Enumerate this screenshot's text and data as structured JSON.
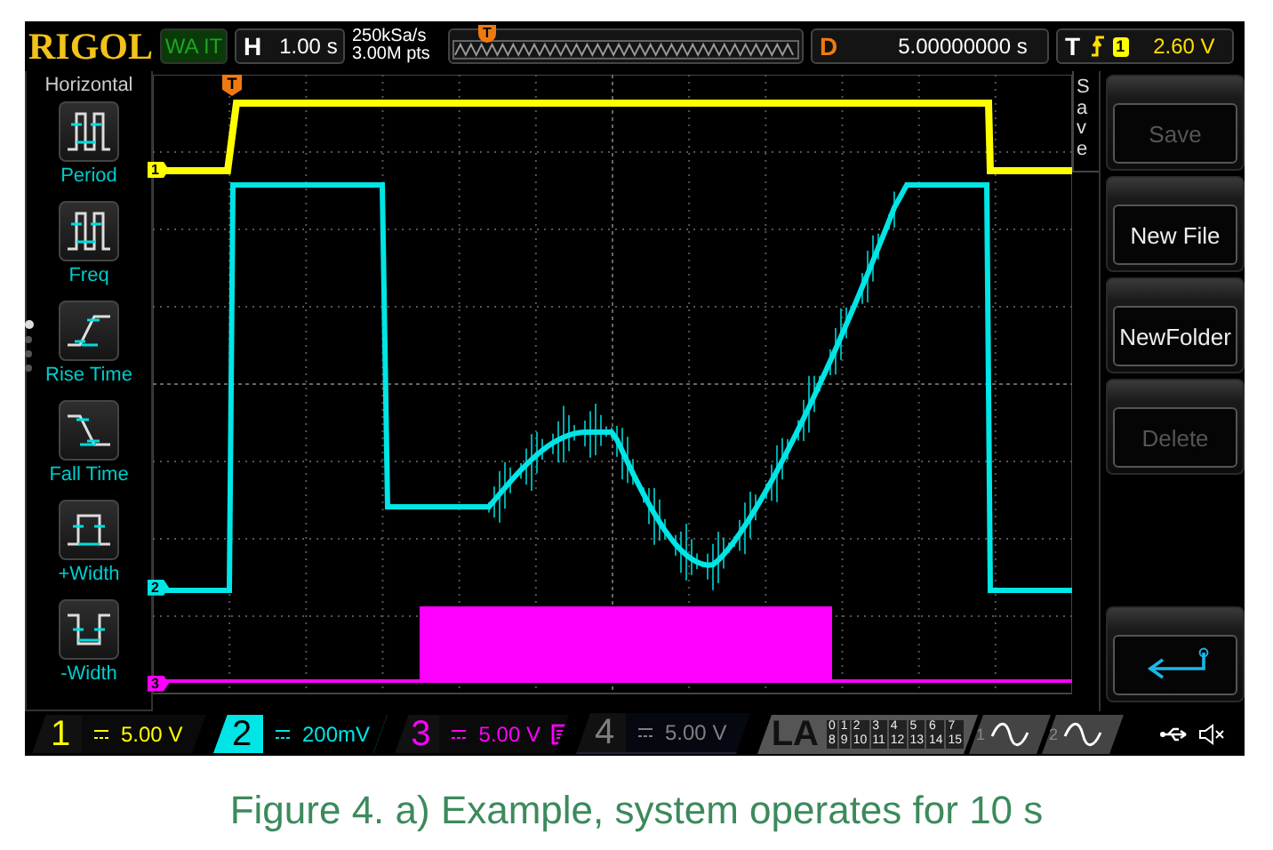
{
  "header": {
    "brand": "RIGOL",
    "run_state": "WA IT",
    "horizontal": {
      "label": "H",
      "value": "1.00 s"
    },
    "sample_rate": "250kSa/s",
    "memory_depth": "3.00M pts",
    "memory_marker": "T",
    "delay": {
      "label": "D",
      "value": "5.00000000 s"
    },
    "trigger": {
      "label": "T",
      "source": "1",
      "level": "2.60 V"
    }
  },
  "left_menu": {
    "title": "Horizontal",
    "items": [
      {
        "kind": "period",
        "label": "Period"
      },
      {
        "kind": "freq",
        "label": "Freq"
      },
      {
        "kind": "rise",
        "label": "Rise Time"
      },
      {
        "kind": "fall",
        "label": "Fall Time"
      },
      {
        "kind": "pwidth",
        "label": "+Width"
      },
      {
        "kind": "nwidth",
        "label": "-Width"
      }
    ],
    "pages": [
      {
        "selected": true
      },
      {
        "selected": false
      },
      {
        "selected": false
      },
      {
        "selected": false
      }
    ]
  },
  "screen": {
    "trigger_marker": "T",
    "channel_markers": [
      {
        "label": "1",
        "color": "#ffff00"
      },
      {
        "label": "2",
        "color": "#00e5e5"
      },
      {
        "label": "3",
        "color": "#ff00ff"
      }
    ]
  },
  "soft_menu": {
    "tab": "Save",
    "buttons": [
      {
        "label": "Save",
        "disabled": true
      },
      {
        "label": "New File",
        "disabled": false
      },
      {
        "label": "NewFolder",
        "disabled": false
      },
      {
        "label": "Delete",
        "disabled": true
      }
    ]
  },
  "channels": [
    {
      "number": "1",
      "scale": "5.00 V",
      "color": "#ffff00",
      "on": true,
      "selected": false,
      "bw_limit": false
    },
    {
      "number": "2",
      "scale": "200mV",
      "color": "#00e5e5",
      "on": true,
      "selected": true,
      "bw_limit": false
    },
    {
      "number": "3",
      "scale": "5.00 V",
      "color": "#ff00ff",
      "on": true,
      "selected": false,
      "bw_limit": true
    },
    {
      "number": "4",
      "scale": "5.00 V",
      "color": "#808080",
      "on": false,
      "selected": false,
      "bw_limit": false
    }
  ],
  "logic": {
    "label": "LA",
    "bits": [
      "0",
      "1",
      "2",
      "3",
      "4",
      "5",
      "6",
      "7",
      "8",
      "9",
      "10",
      "11",
      "12",
      "13",
      "14",
      "15"
    ]
  },
  "generators": [
    {
      "number": "1"
    },
    {
      "number": "2"
    }
  ],
  "caption": "Figure 4. a) Example, system operates for 10 s"
}
